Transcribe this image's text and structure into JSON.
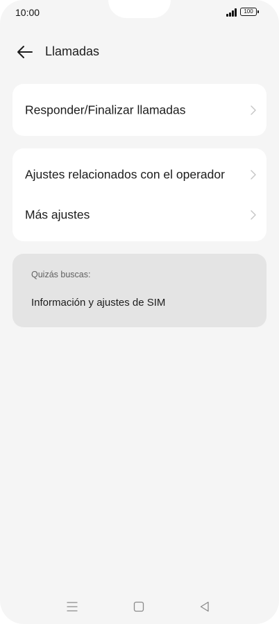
{
  "status_bar": {
    "time": "10:00",
    "battery_level": "100",
    "signal_bars": 4
  },
  "header": {
    "back_icon": "arrow-left-icon",
    "title": "Llamadas"
  },
  "cards": [
    {
      "items": [
        {
          "label": "Responder/Finalizar llamadas",
          "icon": "chevron-right-icon"
        }
      ]
    },
    {
      "items": [
        {
          "label": "Ajustes relacionados con el operador",
          "icon": "chevron-right-icon"
        },
        {
          "label": "Más ajustes",
          "icon": "chevron-right-icon"
        }
      ]
    }
  ],
  "suggestions": {
    "heading": "Quizás buscas:",
    "items": [
      {
        "label": "Información y ajustes de SIM"
      }
    ]
  },
  "nav_bar": {
    "buttons": [
      "menu-icon",
      "home-icon",
      "back-triangle-icon"
    ]
  },
  "colors": {
    "background": "#f5f5f5",
    "card": "#ffffff",
    "suggestion_card": "#e4e4e4",
    "text": "#1c1c1c",
    "secondary_text": "#5f5f5f",
    "chevron": "#c4c4c4"
  }
}
